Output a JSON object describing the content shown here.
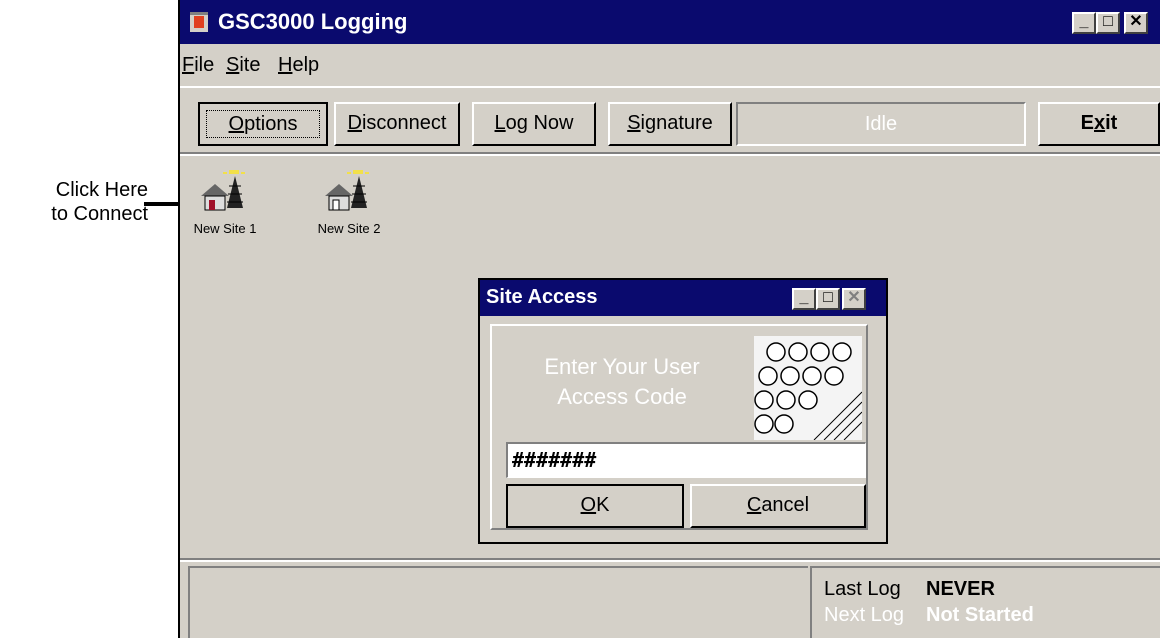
{
  "annotation": {
    "line1": "Click Here",
    "line2": "to Connect"
  },
  "window": {
    "title": "GSC3000 Logging",
    "controls": {
      "minimize": "_",
      "maximize": "□",
      "close": "✕"
    }
  },
  "menu": [
    {
      "label": "File",
      "accel": "F",
      "rest": "ile"
    },
    {
      "label": "Site",
      "accel": "S",
      "rest": "ite"
    },
    {
      "label": "Help",
      "accel": "H",
      "rest": "elp"
    }
  ],
  "toolbar": {
    "options": {
      "accel": "O",
      "rest": "ptions"
    },
    "disconnect": {
      "accel": "D",
      "rest": "isconnect"
    },
    "lognow": {
      "accel": "L",
      "rest": "og Now"
    },
    "signature": {
      "accel": "S",
      "rest": "ignature"
    },
    "status": "Idle",
    "exit": {
      "pre": "E",
      "accel": "x",
      "rest": "it"
    }
  },
  "sites": [
    {
      "label": "New Site 1"
    },
    {
      "label": "New Site 2"
    }
  ],
  "dialog": {
    "title": "Site Access",
    "prompt_line1": "Enter Your User",
    "prompt_line2": "Access Code",
    "code_value": "#######",
    "ok": {
      "accel": "O",
      "rest": "K"
    },
    "cancel": {
      "accel": "C",
      "rest": "ancel"
    }
  },
  "log": {
    "last_label": "Last Log",
    "last_value": "NEVER",
    "next_label": "Next Log",
    "next_value": "Not Started"
  },
  "colors": {
    "titlebar": "#0a0a6e",
    "face": "#d4d0c8",
    "disabled_text": "#ffffff"
  }
}
